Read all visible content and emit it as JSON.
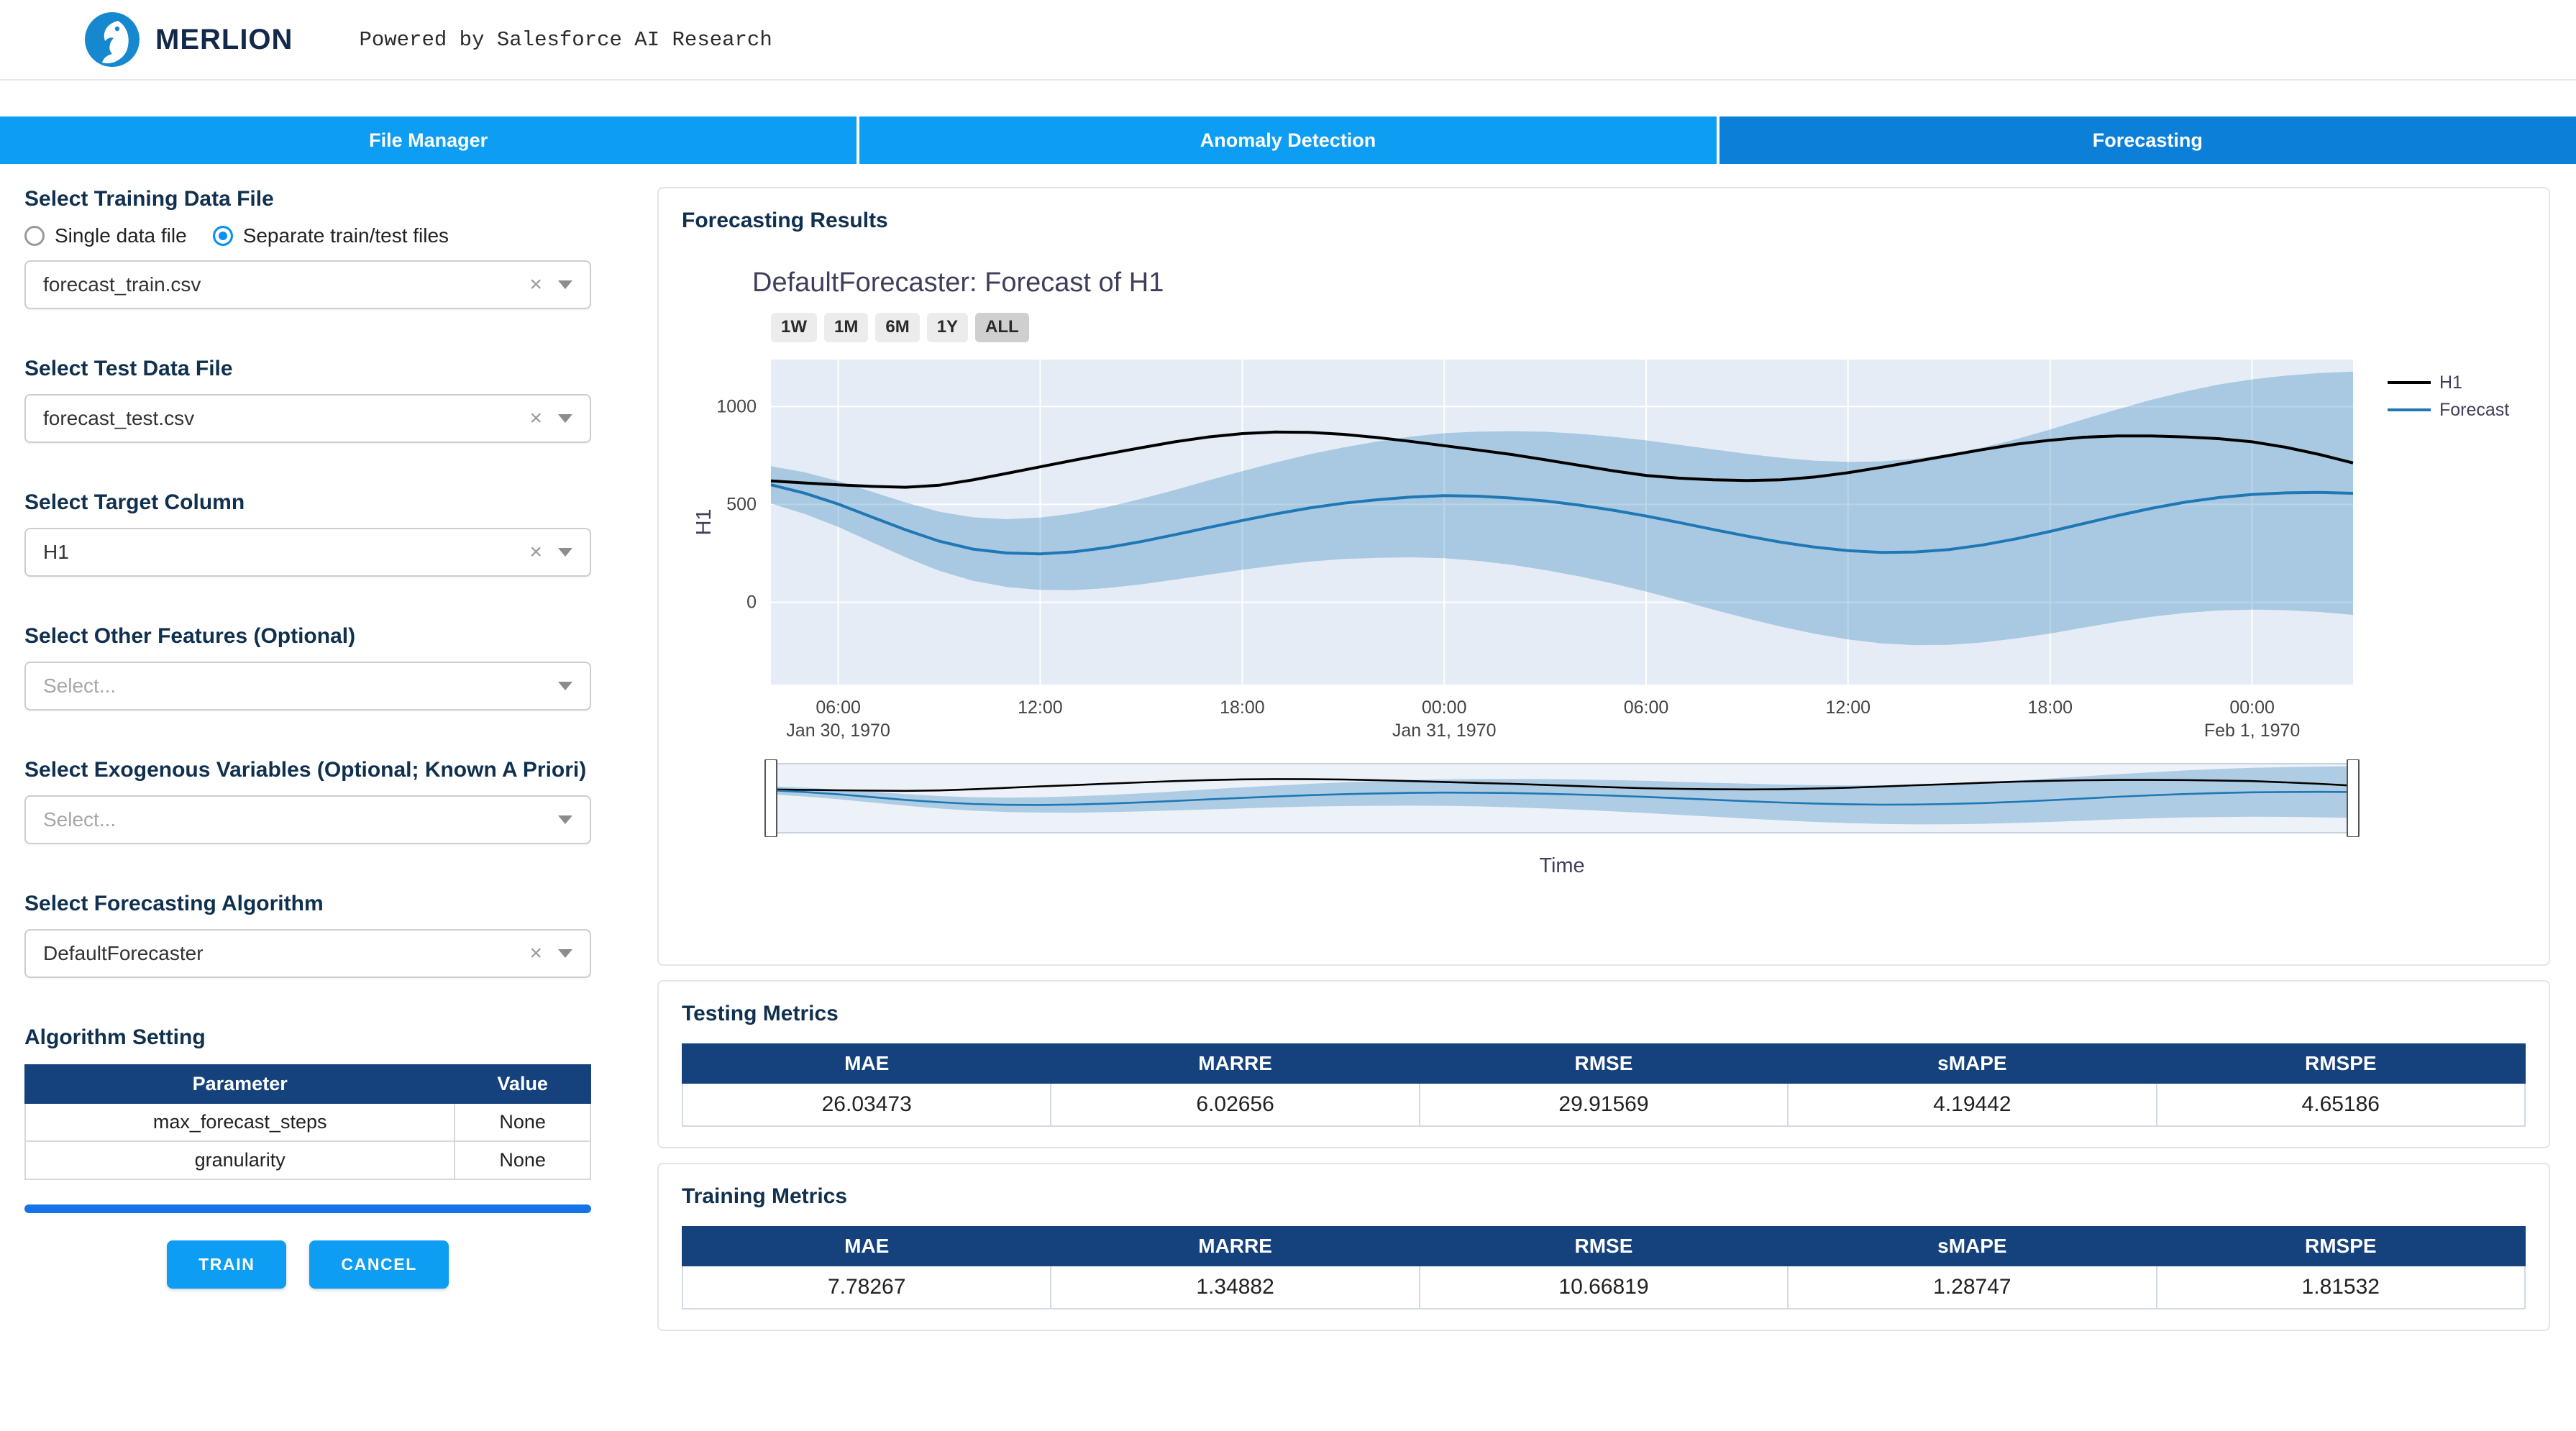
{
  "header": {
    "brand": "MERLION",
    "tagline": "Powered by Salesforce AI Research"
  },
  "tabs": [
    {
      "label": "File Manager",
      "active": false
    },
    {
      "label": "Anomaly Detection",
      "active": false
    },
    {
      "label": "Forecasting",
      "active": true
    }
  ],
  "ui": {
    "clear_icon": "×"
  },
  "colors": {
    "tab_inactive": "#0d9df3",
    "tab_active": "#0c80d8",
    "table_header": "#15427c",
    "progress": "#1473e6",
    "button": "#0d9df3",
    "h1_line": "#000000",
    "forecast_line": "#1f77b4",
    "plot_bg": "#e5ecf6"
  },
  "sidebar": {
    "training_file": {
      "label": "Select Training Data File",
      "radio_options": [
        {
          "label": "Single data file",
          "selected": false
        },
        {
          "label": "Separate train/test files",
          "selected": true
        }
      ],
      "value": "forecast_train.csv"
    },
    "test_file": {
      "label": "Select Test Data File",
      "value": "forecast_test.csv"
    },
    "target_column": {
      "label": "Select Target Column",
      "value": "H1"
    },
    "other_features": {
      "label": "Select Other Features (Optional)",
      "placeholder": "Select..."
    },
    "exog_vars": {
      "label": "Select Exogenous Variables (Optional; Known A Priori)",
      "placeholder": "Select..."
    },
    "algorithm": {
      "label": "Select Forecasting Algorithm",
      "value": "DefaultForecaster"
    },
    "algorithm_setting": {
      "label": "Algorithm Setting",
      "columns": [
        "Parameter",
        "Value"
      ],
      "rows": [
        [
          "max_forecast_steps",
          "None"
        ],
        [
          "granularity",
          "None"
        ]
      ]
    },
    "train_button": "TRAIN",
    "cancel_button": "CANCEL"
  },
  "results": {
    "title": "Forecasting Results",
    "chart_title": "DefaultForecaster: Forecast of H1",
    "range_buttons": [
      "1W",
      "1M",
      "6M",
      "1Y",
      "ALL"
    ],
    "active_range": "ALL",
    "xaxis_title": "Time"
  },
  "testing_metrics": {
    "title": "Testing Metrics",
    "columns": [
      "MAE",
      "MARRE",
      "RMSE",
      "sMAPE",
      "RMSPE"
    ],
    "values": [
      "26.03473",
      "6.02656",
      "29.91569",
      "4.19442",
      "4.65186"
    ]
  },
  "training_metrics": {
    "title": "Training Metrics",
    "columns": [
      "MAE",
      "MARRE",
      "RMSE",
      "sMAPE",
      "RMSPE"
    ],
    "values": [
      "7.78267",
      "1.34882",
      "10.66819",
      "1.28747",
      "1.81532"
    ]
  },
  "chart_data": {
    "type": "line",
    "title": "DefaultForecaster: Forecast of H1",
    "xlabel": "Time",
    "ylabel": "H1",
    "ylim": [
      -420,
      1240
    ],
    "yticks": [
      0,
      500,
      1000
    ],
    "grid": true,
    "legend_position": "right",
    "plot_bg": "#e5ecf6",
    "x_unit": "hours from Jan 30, 1970 04:00",
    "xticks": [
      {
        "t": 2,
        "time": "06:00",
        "date": "Jan 30, 1970"
      },
      {
        "t": 8,
        "time": "12:00",
        "date": ""
      },
      {
        "t": 14,
        "time": "18:00",
        "date": ""
      },
      {
        "t": 20,
        "time": "00:00",
        "date": "Jan 31, 1970"
      },
      {
        "t": 26,
        "time": "06:00",
        "date": ""
      },
      {
        "t": 32,
        "time": "12:00",
        "date": ""
      },
      {
        "t": 38,
        "time": "18:00",
        "date": ""
      },
      {
        "t": 44,
        "time": "00:00",
        "date": "Feb 1, 1970"
      }
    ],
    "series": [
      {
        "name": "H1",
        "color": "#000000",
        "values": [
          620,
          610,
          600,
          592,
          588,
          598,
          625,
          658,
          692,
          726,
          758,
          790,
          820,
          845,
          862,
          870,
          868,
          858,
          842,
          822,
          800,
          778,
          755,
          728,
          700,
          672,
          648,
          634,
          626,
          622,
          626,
          640,
          662,
          690,
          720,
          750,
          780,
          808,
          828,
          843,
          850,
          850,
          845,
          836,
          820,
          792,
          755,
          712
        ]
      },
      {
        "name": "Forecast",
        "color": "#1f77b4",
        "values": [
          600,
          558,
          502,
          436,
          370,
          312,
          272,
          252,
          248,
          258,
          280,
          310,
          345,
          382,
          418,
          452,
          482,
          506,
          524,
          538,
          545,
          542,
          533,
          518,
          497,
          471,
          441,
          407,
          372,
          338,
          307,
          282,
          264,
          255,
          257,
          270,
          293,
          325,
          362,
          403,
          443,
          480,
          511,
          535,
          551,
          559,
          561,
          557
        ]
      }
    ],
    "band": {
      "color": "#1f77b4",
      "opacity": 0.3,
      "upper": [
        695,
        664,
        619,
        565,
        510,
        463,
        434,
        425,
        433,
        454,
        487,
        528,
        574,
        623,
        670,
        715,
        756,
        791,
        821,
        846,
        864,
        872,
        874,
        871,
        861,
        846,
        827,
        804,
        781,
        758,
        738,
        724,
        717,
        720,
        733,
        757,
        791,
        834,
        883,
        935,
        986,
        1034,
        1076,
        1112,
        1139,
        1158,
        1171,
        1178
      ],
      "lower": [
        505,
        452,
        385,
        307,
        230,
        161,
        110,
        79,
        63,
        62,
        73,
        92,
        116,
        141,
        166,
        189,
        208,
        221,
        227,
        230,
        226,
        212,
        192,
        165,
        133,
        96,
        55,
        10,
        -37,
        -82,
        -124,
        -160,
        -189,
        -210,
        -219,
        -217,
        -205,
        -184,
        -159,
        -129,
        -100,
        -74,
        -54,
        -42,
        -37,
        -40,
        -49,
        -64
      ]
    }
  }
}
